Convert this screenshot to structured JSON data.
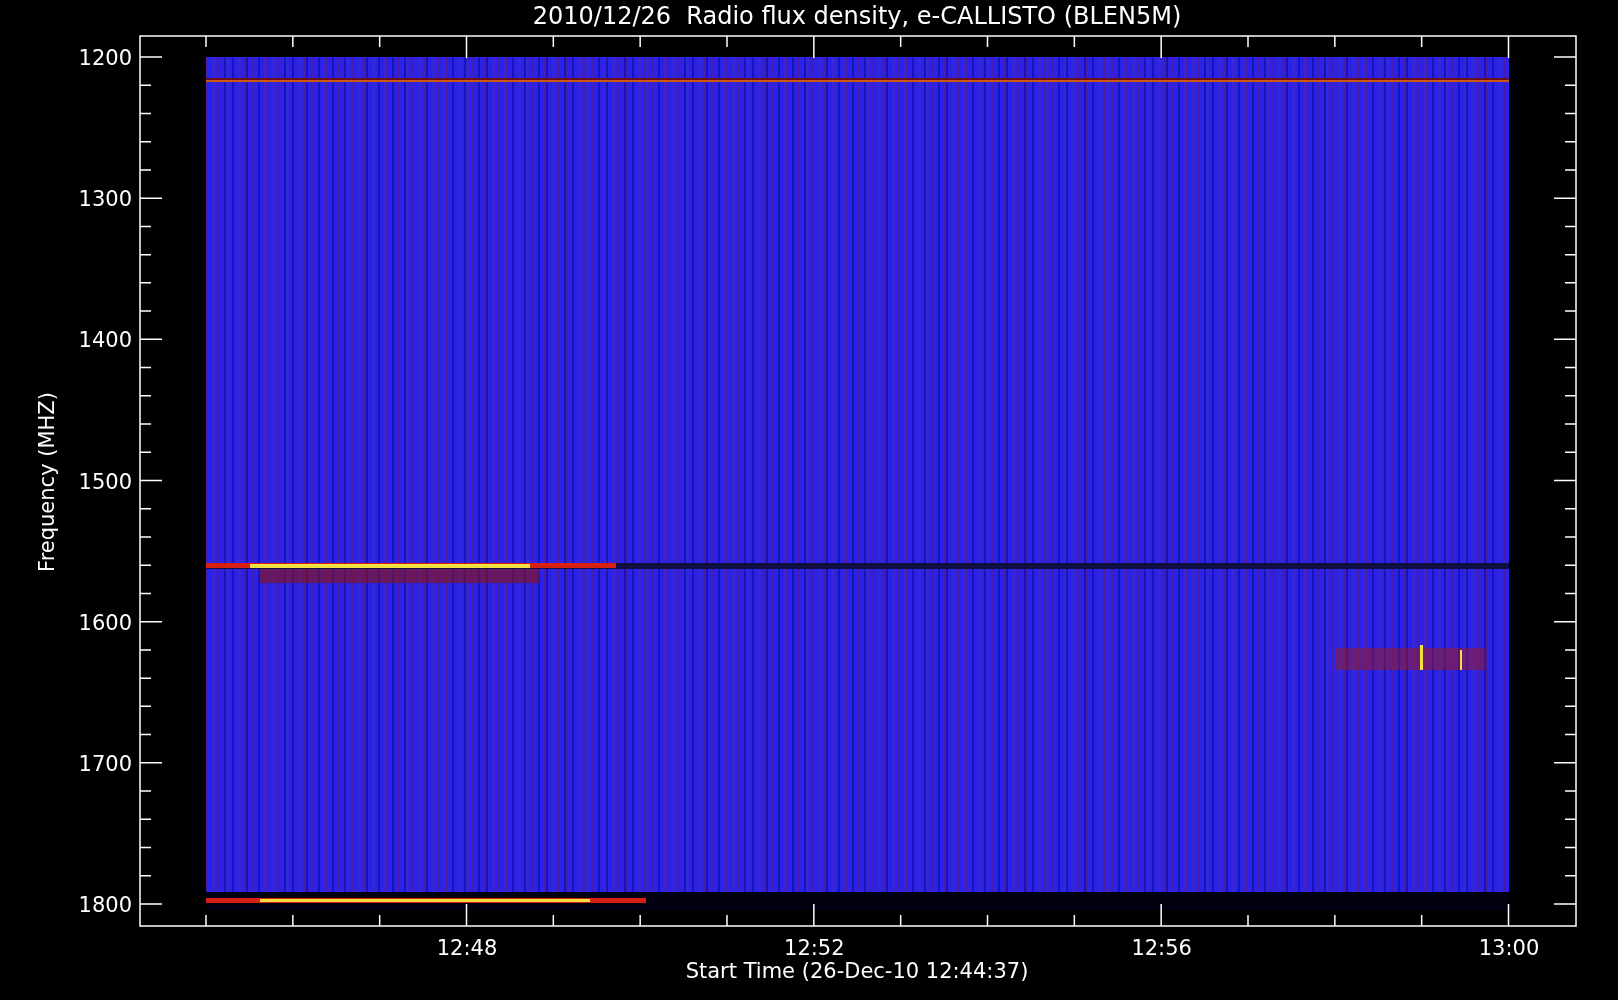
{
  "title": "2010/12/26  Radio flux density, e-CALLISTO (BLEN5M)",
  "y_axis": {
    "label": "Frequency (MHZ)",
    "ticks": [
      "1200",
      "1300",
      "1400",
      "1500",
      "1600",
      "1700",
      "1800"
    ]
  },
  "x_axis": {
    "label": "Start Time (26-Dec-10 12:44:37)",
    "ticks": [
      "12:48",
      "12:52",
      "12:56",
      "13:00"
    ]
  }
}
